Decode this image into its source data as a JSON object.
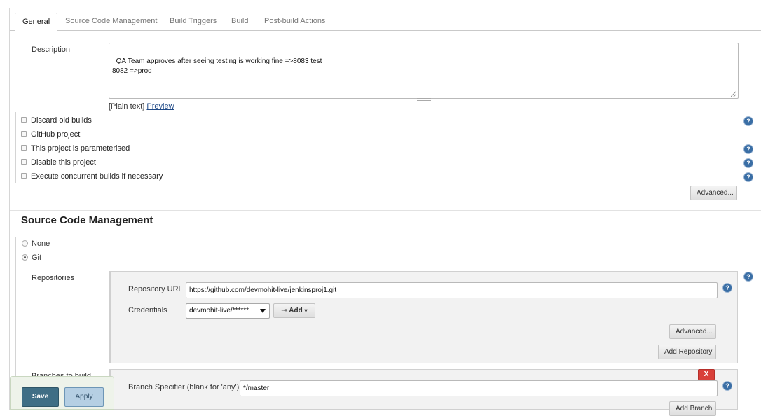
{
  "tabs": [
    {
      "label": "General"
    },
    {
      "label": "Source Code Management"
    },
    {
      "label": "Build Triggers"
    },
    {
      "label": "Build"
    },
    {
      "label": "Post-build Actions"
    }
  ],
  "general": {
    "description_label": "Description",
    "description_value": "QA Team approves after seeing testing is working fine =>8083 test\n8082 =>prod",
    "plain_text": "[Plain text]",
    "preview_link": "Preview",
    "options": [
      {
        "label": "Discard old builds",
        "checked": false
      },
      {
        "label": "GitHub project",
        "checked": false
      },
      {
        "label": "This project is parameterised",
        "checked": false
      },
      {
        "label": "Disable this project",
        "checked": false
      },
      {
        "label": "Execute concurrent builds if necessary",
        "checked": false
      }
    ],
    "advanced_button": "Advanced..."
  },
  "scm": {
    "title": "Source Code Management",
    "options": [
      {
        "label": "None",
        "selected": false
      },
      {
        "label": "Git",
        "selected": true
      }
    ],
    "repositories_label": "Repositories",
    "repository_url_label": "Repository URL",
    "repository_url_value": "https://github.com/devmohit-live/jenkinsproj1.git",
    "credentials_label": "Credentials",
    "credentials_value": "devmohit-live/******",
    "add_button": "Add",
    "advanced_button": "Advanced...",
    "add_repository_button": "Add Repository",
    "branches_label": "Branches to build",
    "delete_button": "X",
    "branch_specifier_label": "Branch Specifier (blank for 'any')",
    "branch_specifier_value": "*/master",
    "add_branch_button": "Add Branch"
  },
  "actions": {
    "save": "Save",
    "apply": "Apply"
  },
  "help_icon_glyph": "?",
  "colors": {
    "save": "#3f6e85",
    "apply": "#b5cfe3",
    "delete": "#d9403a",
    "help": "#3a6ea5"
  }
}
